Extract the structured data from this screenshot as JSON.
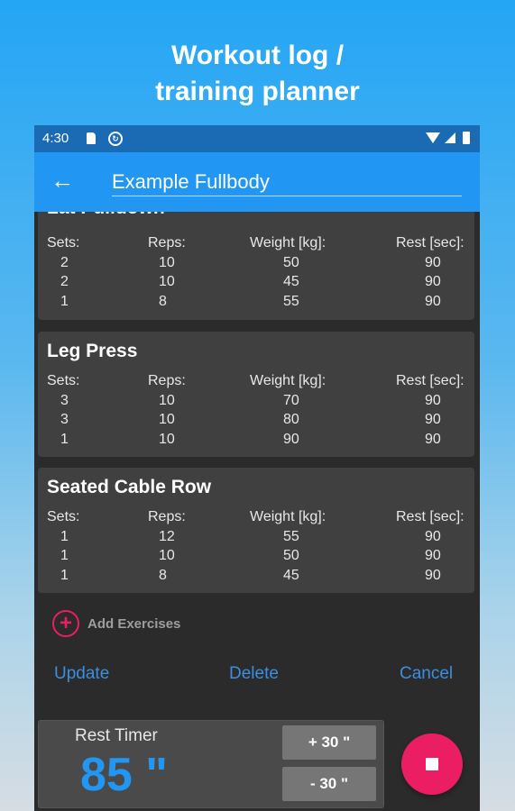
{
  "promo": {
    "line1": "Workout log /",
    "line2": "training planner"
  },
  "status_bar": {
    "time": "4:30"
  },
  "app_bar": {
    "back_icon": "arrow-left-icon",
    "title": "Example Fullbody"
  },
  "column_headers": {
    "sets": "Sets:",
    "reps": "Reps:",
    "weight": "Weight [kg]:",
    "rest": "Rest [sec]:"
  },
  "exercises": [
    {
      "name": "Lat Pulldown",
      "rows": [
        {
          "sets": "2",
          "reps": "10",
          "weight": "50",
          "rest": "90"
        },
        {
          "sets": "2",
          "reps": "10",
          "weight": "45",
          "rest": "90"
        },
        {
          "sets": "1",
          "reps": "8",
          "weight": "55",
          "rest": "90"
        }
      ]
    },
    {
      "name": "Leg Press",
      "rows": [
        {
          "sets": "3",
          "reps": "10",
          "weight": "70",
          "rest": "90"
        },
        {
          "sets": "3",
          "reps": "10",
          "weight": "80",
          "rest": "90"
        },
        {
          "sets": "1",
          "reps": "10",
          "weight": "90",
          "rest": "90"
        }
      ]
    },
    {
      "name": "Seated Cable Row",
      "rows": [
        {
          "sets": "1",
          "reps": "12",
          "weight": "55",
          "rest": "90"
        },
        {
          "sets": "1",
          "reps": "10",
          "weight": "50",
          "rest": "90"
        },
        {
          "sets": "1",
          "reps": "8",
          "weight": "45",
          "rest": "90"
        }
      ]
    }
  ],
  "add_exercises": {
    "icon": "plus-circle-icon",
    "label": "Add Exercises"
  },
  "actions": {
    "update": "Update",
    "delete": "Delete",
    "cancel": "Cancel"
  },
  "rest_timer": {
    "label": "Rest Timer",
    "value": "85 \"",
    "plus_label": "+ 30 \"",
    "minus_label": "- 30 \""
  },
  "fab": {
    "icon": "stop-icon"
  },
  "colors": {
    "app_bar": "#2196f3",
    "status_bar": "#1b6bb4",
    "accent": "#ec1e63",
    "action_text": "#3b8fe0"
  }
}
